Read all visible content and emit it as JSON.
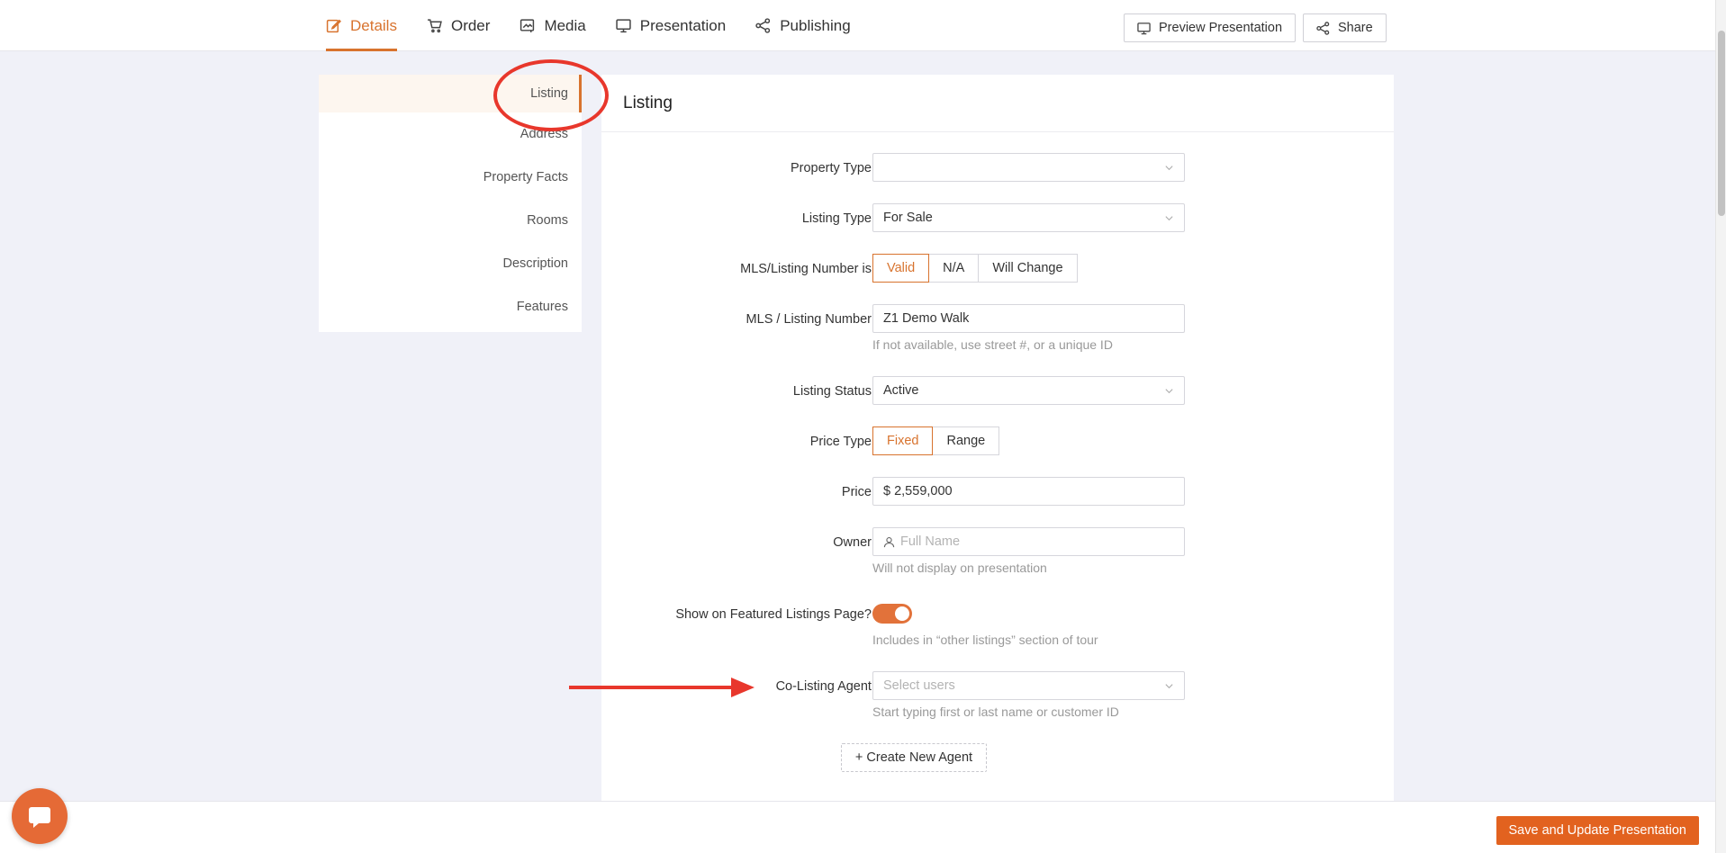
{
  "nav": {
    "tabs": [
      {
        "label": "Details",
        "icon": "edit-icon",
        "active": true
      },
      {
        "label": "Order",
        "icon": "cart-icon"
      },
      {
        "label": "Media",
        "icon": "media-icon"
      },
      {
        "label": "Presentation",
        "icon": "monitor-icon"
      },
      {
        "label": "Publishing",
        "icon": "share-nodes-icon"
      }
    ],
    "preview_label": "Preview Presentation",
    "share_label": "Share"
  },
  "subnav": {
    "items": [
      "Listing",
      "Address",
      "Property Facts",
      "Rooms",
      "Description",
      "Features"
    ],
    "active": "Listing"
  },
  "form": {
    "title": "Listing",
    "property_type": {
      "label": "Property Type",
      "value": ""
    },
    "listing_type": {
      "label": "Listing Type",
      "value": "For Sale"
    },
    "mls_is": {
      "label": "MLS/Listing Number is",
      "options": [
        "Valid",
        "N/A",
        "Will Change"
      ],
      "selected": "Valid"
    },
    "mls_number": {
      "label": "MLS / Listing Number",
      "value": "Z1 Demo Walk",
      "hint": "If not available, use street #, or a unique ID"
    },
    "listing_status": {
      "label": "Listing Status",
      "value": "Active"
    },
    "price_type": {
      "label": "Price Type",
      "options": [
        "Fixed",
        "Range"
      ],
      "selected": "Fixed"
    },
    "price": {
      "label": "Price",
      "value": "$ 2,559,000"
    },
    "owner": {
      "label": "Owner",
      "placeholder": "Full Name",
      "hint": "Will not display on presentation"
    },
    "featured": {
      "label": "Show on Featured Listings Page?",
      "on": true,
      "hint": "Includes in “other listings” section of tour"
    },
    "co_agent": {
      "label": "Co-Listing Agent",
      "placeholder": "Select users",
      "hint": "Start typing first or last name or customer ID"
    },
    "create_agent_label": "+ Create New Agent"
  },
  "footer": {
    "save_label": "Save and Update Presentation"
  },
  "colors": {
    "accent": "#d8732e",
    "save_button": "#e2621f",
    "annotation": "#e8372c",
    "background": "#f0f1f8"
  }
}
